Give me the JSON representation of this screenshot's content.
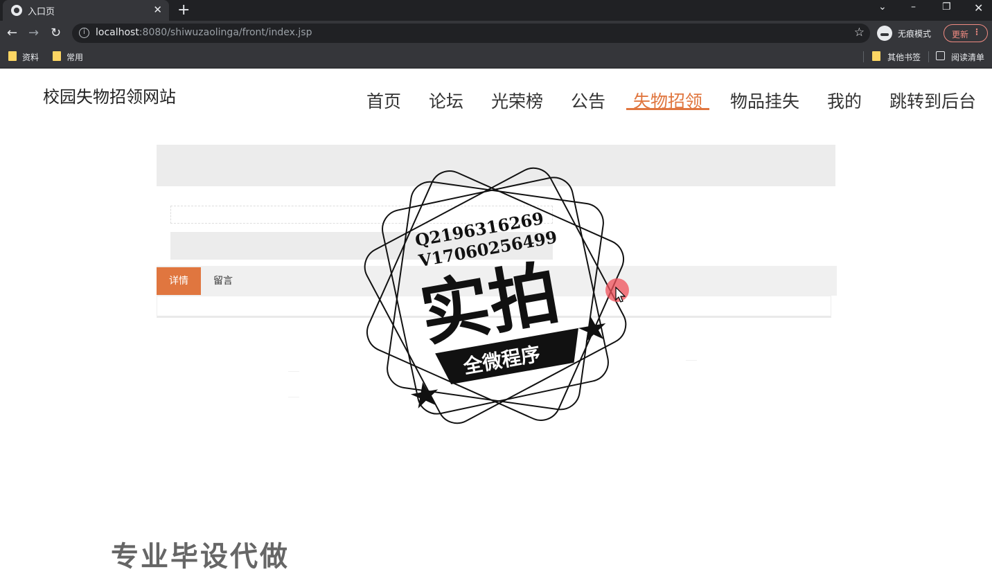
{
  "browser": {
    "tab_title": "入口页",
    "url_host": "localhost",
    "url_path": ":8080/shiwuzaolinga/front/index.jsp",
    "incognito_label": "无痕模式",
    "update_label": "更新",
    "bookmarks": [
      "资料",
      "常用"
    ],
    "other_bookmarks": "其他书签",
    "reading_list": "阅读清单"
  },
  "site": {
    "title": "校园失物招领网站",
    "nav": [
      "首页",
      "论坛",
      "光荣榜",
      "公告",
      "失物招领",
      "物品挂失",
      "我的",
      "跳转到后台"
    ],
    "active_nav": "失物招领"
  },
  "detail": {
    "tabs": [
      "详情",
      "留言"
    ],
    "active_tab": "详情"
  },
  "watermark": {
    "line1": "Q2196316269",
    "line2": "V17060256499",
    "big": "实拍",
    "banner": "全微程序"
  },
  "promo_text": "专业毕设代做",
  "colors": {
    "accent": "#e0763f",
    "chrome_dark": "#202124",
    "chrome": "#35363a"
  }
}
